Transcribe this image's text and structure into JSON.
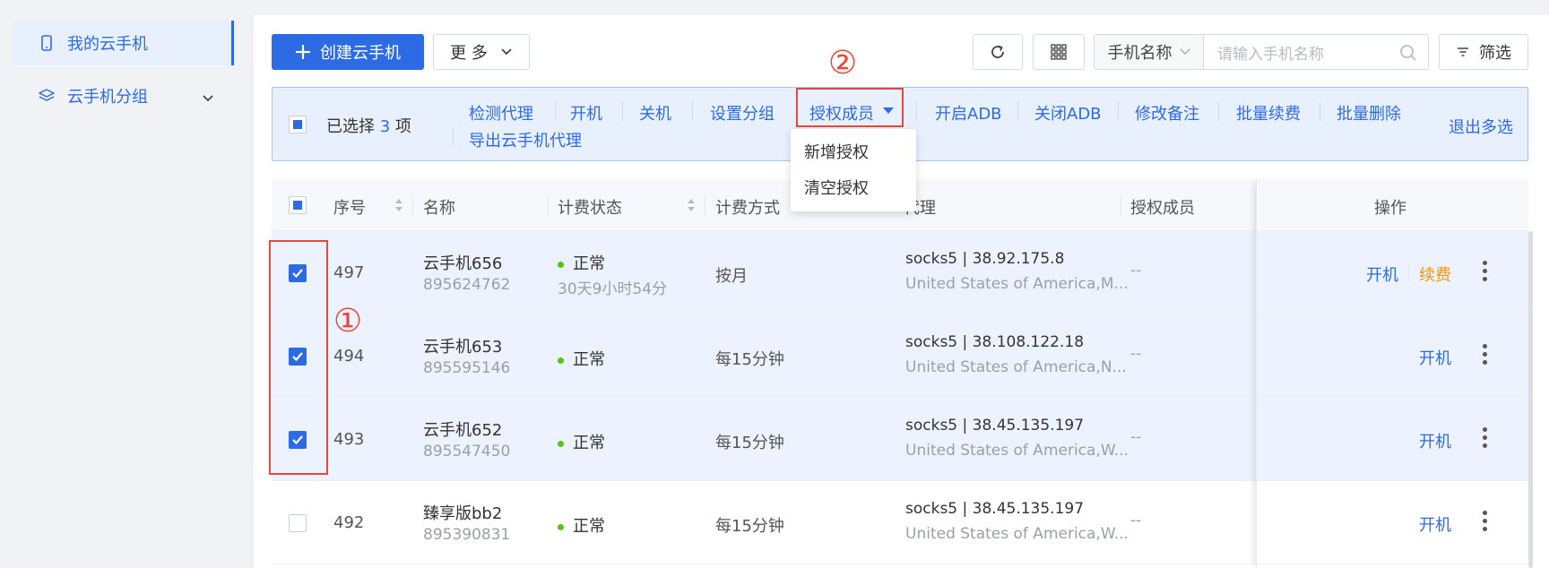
{
  "sidebar": {
    "items": [
      {
        "label": "我的云手机",
        "icon": "phone-icon"
      },
      {
        "label": "云手机分组",
        "icon": "layers-icon"
      }
    ]
  },
  "toolbar": {
    "create_label": "创建云手机",
    "more_label": "更 多",
    "search_field_label": "手机名称",
    "search_placeholder": "请输入手机名称",
    "filter_label": "筛选"
  },
  "selection_bar": {
    "selected_prefix": "已选择",
    "selected_count": "3",
    "selected_suffix": "项",
    "actions": [
      "检测代理",
      "开机",
      "关机",
      "设置分组",
      "授权成员",
      "开启ADB",
      "关闭ADB",
      "修改备注",
      "批量续费",
      "批量删除"
    ],
    "export_label": "导出云手机代理",
    "exit_label": "退出多选"
  },
  "dropdown": {
    "items": [
      "新增授权",
      "清空授权"
    ]
  },
  "annotations": {
    "one": "①",
    "two": "②"
  },
  "table": {
    "headers": {
      "index": "序号",
      "name": "名称",
      "billing_status": "计费状态",
      "billing_method": "计费方式",
      "proxy": "代理",
      "members": "授权成员",
      "ops": "操作"
    },
    "rows": [
      {
        "index": "497",
        "name": "云手机656",
        "id": "895624762",
        "status": "正常",
        "remaining": "30天9小时54分",
        "method": "按月",
        "proxy": "socks5 | 38.92.175.8",
        "location": "United States of America,M...",
        "members": "--",
        "op1": "开机",
        "op2": "续费",
        "selected": true
      },
      {
        "index": "494",
        "name": "云手机653",
        "id": "895595146",
        "status": "正常",
        "remaining": "",
        "method": "每15分钟",
        "proxy": "socks5 | 38.108.122.18",
        "location": "United States of America,N...",
        "members": "--",
        "op1": "开机",
        "op2": "",
        "selected": true
      },
      {
        "index": "493",
        "name": "云手机652",
        "id": "895547450",
        "status": "正常",
        "remaining": "",
        "method": "每15分钟",
        "proxy": "socks5 | 38.45.135.197",
        "location": "United States of America,W...",
        "members": "--",
        "op1": "开机",
        "op2": "",
        "selected": true
      },
      {
        "index": "492",
        "name": "臻享版bb2",
        "id": "895390831",
        "status": "正常",
        "remaining": "",
        "method": "每15分钟",
        "proxy": "socks5 | 38.45.135.197",
        "location": "United States of America,W...",
        "members": "--",
        "op1": "开机",
        "op2": "",
        "selected": false
      }
    ]
  },
  "colors": {
    "accent": "#2d6be4",
    "renew": "#f0960e",
    "annotation_red": "#e54a3c",
    "status_green": "#52c41a"
  }
}
